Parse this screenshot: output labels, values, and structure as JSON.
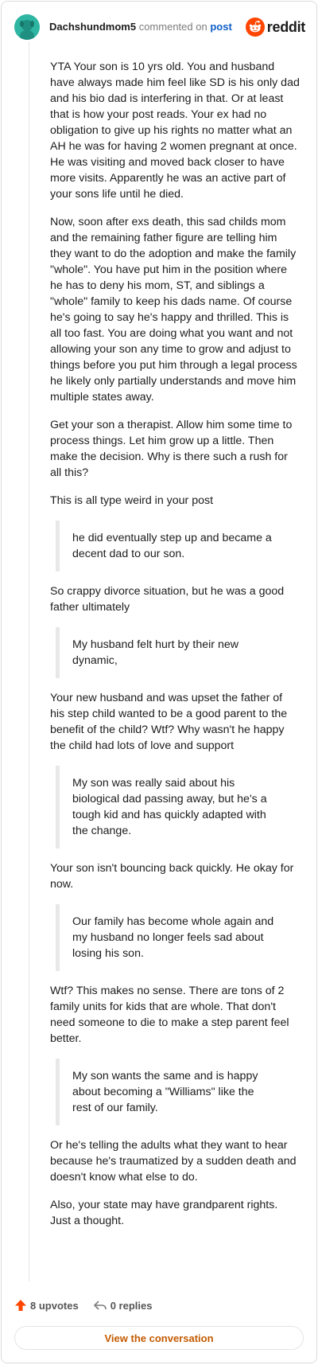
{
  "header": {
    "username": "Dachshundmom5",
    "action_text": "commented on",
    "post_link": "post",
    "logo_word": "reddit"
  },
  "content": {
    "p1": "YTA Your son is 10 yrs old. You and husband have always made him feel like SD is his only dad and his bio dad is interfering in that. Or at least that is how your post reads. Your ex had no obligation to give up his rights no matter what an AH he was for having 2 women pregnant at once. He was visiting and moved back closer to have more visits. Apparently he was an active part of your sons life until he died.",
    "p2": "Now, soon after exs death, this sad childs mom and the remaining father figure are telling him they want to do the adoption and make the family \"whole\". You have put him in the position where he has to deny his mom, ST, and siblings a \"whole\" family to keep his dads name. Of course he's going to say he's happy and thrilled. This is all too fast. You are doing what you want and not allowing your son any time to grow and adjust to things before you put him through a legal process he likely only partially understands and move him multiple states away.",
    "p3": "Get your son a therapist. Allow him some time to process things. Let him grow up a little. Then make the decision. Why is there such a rush for all this?",
    "p4": "This is all type weird in your post",
    "q1": "he did eventually step up and became a decent dad to our son.",
    "p5": "So crappy divorce situation, but he was a good father ultimately",
    "q2": "My husband felt hurt by their new dynamic,",
    "p6": "Your new husband and was upset the father of his step child wanted to be a good parent to the benefit of the child? Wtf? Why wasn't he happy the child had lots of love and support",
    "q3": "My son was really said about his biological dad passing away, but he's a tough kid and has quickly adapted with the change.",
    "p7": "Your son isn't bouncing back quickly. He okay for now.",
    "q4": "Our family has become whole again and my husband no longer feels sad about losing his son.",
    "p8": "Wtf? This makes no sense. There are tons of 2 family units for kids that are whole. That don't need someone to die to make a step parent feel better.",
    "q5": "My son wants the same and is happy about becoming a \"Williams\" like the rest of our family.",
    "p9": "Or he's telling the adults what they want to hear because he's traumatized by a sudden death and doesn't know what else to do.",
    "p10": "Also, your state may have grandparent rights. Just a thought."
  },
  "footer": {
    "upvotes": "8 upvotes",
    "replies": "0 replies",
    "cta": "View the conversation"
  },
  "icons": {
    "avatar": "dog-avatar-icon",
    "logo": "reddit-alien-icon",
    "upvote": "upvote-arrow-icon",
    "reply": "reply-arrow-icon"
  },
  "colors": {
    "avatar_bg": "#2fb6a3",
    "reddit_orange": "#ff4500",
    "link_blue": "#0f5ec7",
    "cta_text": "#c45a00"
  }
}
